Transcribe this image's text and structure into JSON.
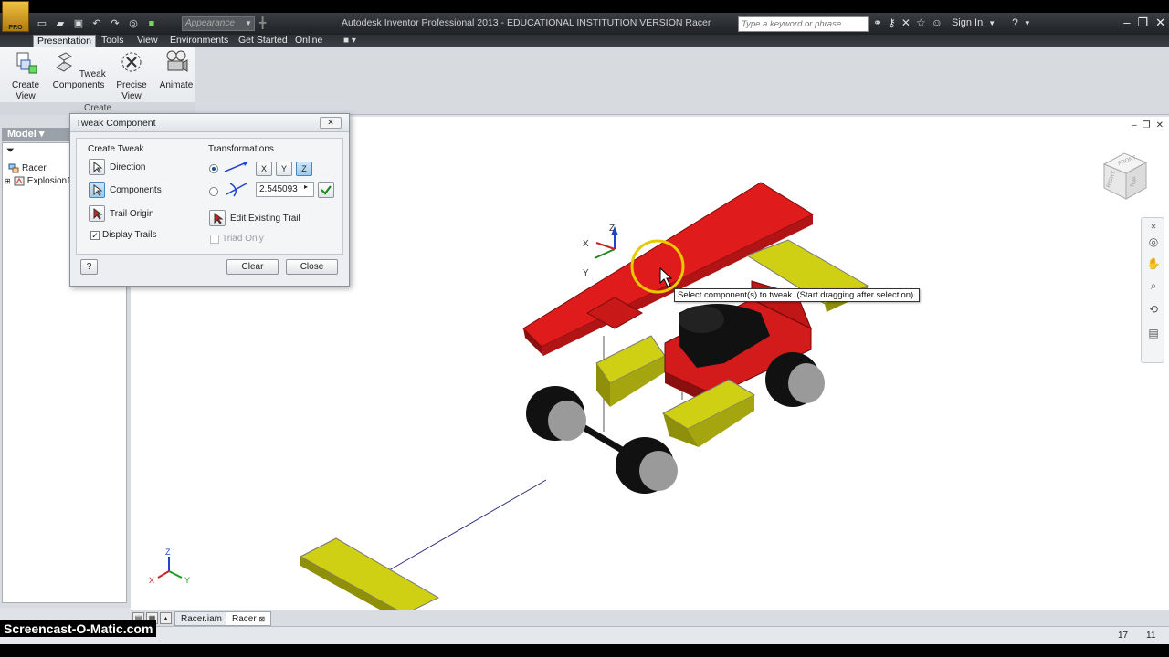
{
  "app": {
    "title": "Autodesk Inventor Professional 2013 - EDUCATIONAL INSTITUTION VERSION   Racer",
    "logo_text": "PRO",
    "appearance_placeholder": "Appearance",
    "search_placeholder": "Type a keyword or phrase",
    "sign_in": "Sign In"
  },
  "menu": {
    "tabs": [
      "Presentation",
      "Tools",
      "View",
      "Environments",
      "Get Started",
      "Online"
    ],
    "active": "Presentation"
  },
  "ribbon": {
    "panel_label": "Create",
    "buttons": [
      {
        "label": "Create View",
        "icon": "create-view-icon"
      },
      {
        "label": "Tweak Components",
        "icon": "tweak-components-icon"
      },
      {
        "label": "Precise View Rotation",
        "icon": "precise-view-rotation-icon"
      },
      {
        "label": "Animate",
        "icon": "animate-icon"
      }
    ]
  },
  "browser": {
    "header": "Model",
    "items": [
      {
        "label": "Racer",
        "icon": "assembly-icon"
      },
      {
        "label": "Explosion1",
        "icon": "explosion-icon"
      }
    ]
  },
  "dialog": {
    "title": "Tweak Component",
    "create_tweak": {
      "title": "Create Tweak",
      "direction": "Direction",
      "components": "Components",
      "trail_origin": "Trail Origin",
      "display_trails": "Display Trails",
      "display_trails_checked": true
    },
    "transformations": {
      "title": "Transformations",
      "axes": [
        "X",
        "Y",
        "Z"
      ],
      "selected_axis": "Z",
      "value": "2.545093",
      "edit_existing_trail": "Edit Existing Trail",
      "triad_only": "Triad Only"
    },
    "buttons": {
      "clear": "Clear",
      "close": "Close",
      "help": "?"
    }
  },
  "viewport": {
    "tooltip": "Select component(s) to tweak. (Start dragging after selection).",
    "triad_labels": {
      "x": "X",
      "y": "Y",
      "z": "Z"
    },
    "viewcube_faces": [
      "FRONT",
      "RIGHT",
      "TOP"
    ],
    "colors": {
      "body_red": "#e01b1b",
      "part_yellow": "#cfcf14",
      "wheel_black": "#111111",
      "hub_gray": "#9a9a9a"
    }
  },
  "doc_tabs": [
    "Racer.iam",
    "Racer"
  ],
  "doc_tab_active": "Racer",
  "status": {
    "left_num": "17",
    "right_num": "11"
  },
  "watermark": "Screencast-O-Matic.com"
}
